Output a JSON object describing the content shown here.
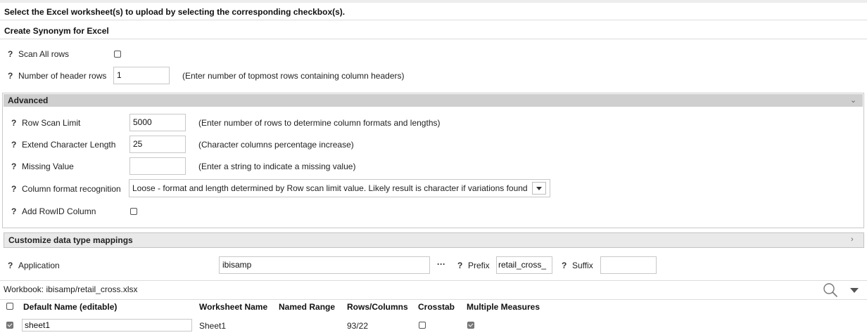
{
  "instruction": "Select the Excel worksheet(s) to upload by selecting the corresponding checkbox(s).",
  "section_title": "Create Synonym for Excel",
  "help_glyph": "?",
  "scan_all_rows": {
    "label": "Scan All rows",
    "checked": false
  },
  "header_rows": {
    "label": "Number of header rows",
    "value": "1",
    "hint": "(Enter number of topmost rows containing column headers)"
  },
  "advanced": {
    "title": "Advanced",
    "row_scan_limit": {
      "label": "Row Scan Limit",
      "value": "5000",
      "hint": "(Enter number of rows to determine column formats and lengths)"
    },
    "extend_char_length": {
      "label": "Extend Character Length",
      "value": "25",
      "hint": "(Character columns percentage increase)"
    },
    "missing_value": {
      "label": "Missing Value",
      "value": "",
      "hint": "(Enter a string to indicate a missing value)"
    },
    "column_format": {
      "label": "Column format recognition",
      "value": "Loose - format and length determined by Row scan limit value. Likely result is character if variations found"
    },
    "add_rowid": {
      "label": "Add RowID Column",
      "checked": false
    }
  },
  "customize": {
    "title": "Customize data type mappings"
  },
  "application": {
    "label": "Application",
    "value": "ibisamp",
    "browse": "···"
  },
  "prefix": {
    "label": "Prefix",
    "value": "retail_cross_"
  },
  "suffix": {
    "label": "Suffix",
    "value": ""
  },
  "workbook": {
    "label": "Workbook: ibisamp/retail_cross.xlsx"
  },
  "table": {
    "columns": [
      "Default Name (editable)",
      "Worksheet Name",
      "Named Range",
      "Rows/Columns",
      "Crosstab",
      "Multiple Measures"
    ],
    "rows": [
      {
        "selected": true,
        "default_name": "sheet1",
        "worksheet": "Sheet1",
        "named_range": "",
        "rows_columns": "93/22",
        "crosstab": false,
        "multiple_measures": true
      }
    ]
  }
}
